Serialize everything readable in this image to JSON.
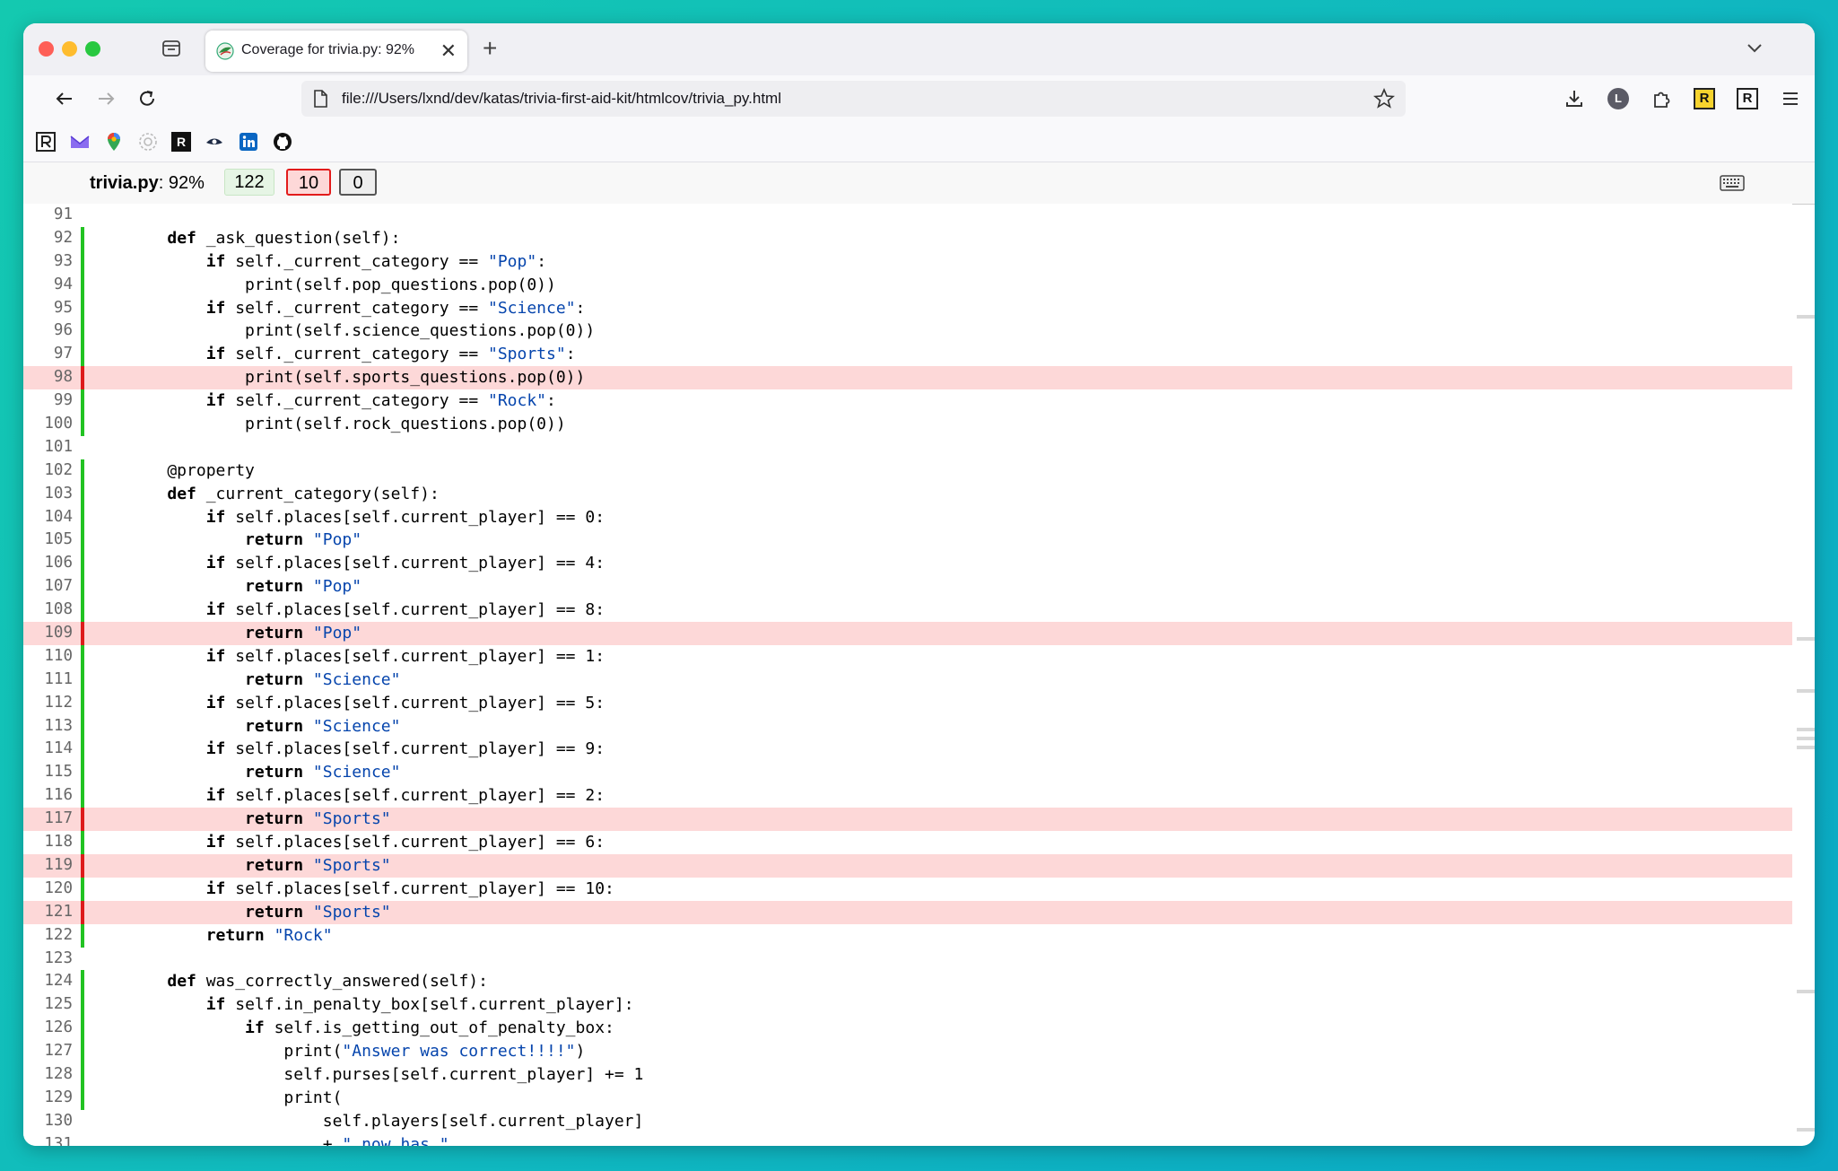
{
  "browser": {
    "tab_title": "Coverage for trivia.py: 92%",
    "tab_close": "✕",
    "new_tab": "+",
    "url": "file:///Users/lxnd/dev/katas/trivia-first-aid-kit/htmlcov/trivia_py.html",
    "avatar_letter": "L",
    "ext_r1": "R",
    "ext_r2": "R",
    "bookmark_r": "R"
  },
  "coverage": {
    "filename": "trivia.py",
    "percent": ": 92%",
    "run": "122",
    "missing": "10",
    "excluded": "0"
  },
  "source_lines": [
    {
      "n": "91",
      "s": "",
      "code": []
    },
    {
      "n": "92",
      "s": "run",
      "code": [
        [
          "    ",
          ""
        ],
        [
          "def",
          "kw"
        ],
        [
          " _ask_question(self):",
          ""
        ]
      ]
    },
    {
      "n": "93",
      "s": "run",
      "code": [
        [
          "        ",
          ""
        ],
        [
          "if",
          "kw"
        ],
        [
          " self._current_category == ",
          ""
        ],
        [
          "\"Pop\"",
          "str"
        ],
        [
          ":",
          ""
        ]
      ]
    },
    {
      "n": "94",
      "s": "run",
      "code": [
        [
          "            print(self.pop_questions.pop(0))",
          ""
        ]
      ]
    },
    {
      "n": "95",
      "s": "run",
      "code": [
        [
          "        ",
          ""
        ],
        [
          "if",
          "kw"
        ],
        [
          " self._current_category == ",
          ""
        ],
        [
          "\"Science\"",
          "str"
        ],
        [
          ":",
          ""
        ]
      ]
    },
    {
      "n": "96",
      "s": "run",
      "code": [
        [
          "            print(self.science_questions.pop(0))",
          ""
        ]
      ]
    },
    {
      "n": "97",
      "s": "run",
      "code": [
        [
          "        ",
          ""
        ],
        [
          "if",
          "kw"
        ],
        [
          " self._current_category == ",
          ""
        ],
        [
          "\"Sports\"",
          "str"
        ],
        [
          ":",
          ""
        ]
      ]
    },
    {
      "n": "98",
      "s": "mis",
      "code": [
        [
          "            print(self.sports_questions.pop(0))",
          ""
        ]
      ]
    },
    {
      "n": "99",
      "s": "run",
      "code": [
        [
          "        ",
          ""
        ],
        [
          "if",
          "kw"
        ],
        [
          " self._current_category == ",
          ""
        ],
        [
          "\"Rock\"",
          "str"
        ],
        [
          ":",
          ""
        ]
      ]
    },
    {
      "n": "100",
      "s": "run",
      "code": [
        [
          "            print(self.rock_questions.pop(0))",
          ""
        ]
      ]
    },
    {
      "n": "101",
      "s": "",
      "code": []
    },
    {
      "n": "102",
      "s": "run",
      "code": [
        [
          "    @property",
          ""
        ]
      ]
    },
    {
      "n": "103",
      "s": "run",
      "code": [
        [
          "    ",
          ""
        ],
        [
          "def",
          "kw"
        ],
        [
          " _current_category(self):",
          ""
        ]
      ]
    },
    {
      "n": "104",
      "s": "run",
      "code": [
        [
          "        ",
          ""
        ],
        [
          "if",
          "kw"
        ],
        [
          " self.places[self.current_player] == 0:",
          ""
        ]
      ]
    },
    {
      "n": "105",
      "s": "run",
      "code": [
        [
          "            ",
          ""
        ],
        [
          "return",
          "kw"
        ],
        [
          " ",
          ""
        ],
        [
          "\"Pop\"",
          "str"
        ]
      ]
    },
    {
      "n": "106",
      "s": "run",
      "code": [
        [
          "        ",
          ""
        ],
        [
          "if",
          "kw"
        ],
        [
          " self.places[self.current_player] == 4:",
          ""
        ]
      ]
    },
    {
      "n": "107",
      "s": "run",
      "code": [
        [
          "            ",
          ""
        ],
        [
          "return",
          "kw"
        ],
        [
          " ",
          ""
        ],
        [
          "\"Pop\"",
          "str"
        ]
      ]
    },
    {
      "n": "108",
      "s": "run",
      "code": [
        [
          "        ",
          ""
        ],
        [
          "if",
          "kw"
        ],
        [
          " self.places[self.current_player] == 8:",
          ""
        ]
      ]
    },
    {
      "n": "109",
      "s": "mis",
      "code": [
        [
          "            ",
          ""
        ],
        [
          "return",
          "kw"
        ],
        [
          " ",
          ""
        ],
        [
          "\"Pop\"",
          "str"
        ]
      ]
    },
    {
      "n": "110",
      "s": "run",
      "code": [
        [
          "        ",
          ""
        ],
        [
          "if",
          "kw"
        ],
        [
          " self.places[self.current_player] == 1:",
          ""
        ]
      ]
    },
    {
      "n": "111",
      "s": "run",
      "code": [
        [
          "            ",
          ""
        ],
        [
          "return",
          "kw"
        ],
        [
          " ",
          ""
        ],
        [
          "\"Science\"",
          "str"
        ]
      ]
    },
    {
      "n": "112",
      "s": "run",
      "code": [
        [
          "        ",
          ""
        ],
        [
          "if",
          "kw"
        ],
        [
          " self.places[self.current_player] == 5:",
          ""
        ]
      ]
    },
    {
      "n": "113",
      "s": "run",
      "code": [
        [
          "            ",
          ""
        ],
        [
          "return",
          "kw"
        ],
        [
          " ",
          ""
        ],
        [
          "\"Science\"",
          "str"
        ]
      ]
    },
    {
      "n": "114",
      "s": "run",
      "code": [
        [
          "        ",
          ""
        ],
        [
          "if",
          "kw"
        ],
        [
          " self.places[self.current_player] == 9:",
          ""
        ]
      ]
    },
    {
      "n": "115",
      "s": "run",
      "code": [
        [
          "            ",
          ""
        ],
        [
          "return",
          "kw"
        ],
        [
          " ",
          ""
        ],
        [
          "\"Science\"",
          "str"
        ]
      ]
    },
    {
      "n": "116",
      "s": "run",
      "code": [
        [
          "        ",
          ""
        ],
        [
          "if",
          "kw"
        ],
        [
          " self.places[self.current_player] == 2:",
          ""
        ]
      ]
    },
    {
      "n": "117",
      "s": "mis",
      "code": [
        [
          "            ",
          ""
        ],
        [
          "return",
          "kw"
        ],
        [
          " ",
          ""
        ],
        [
          "\"Sports\"",
          "str"
        ]
      ]
    },
    {
      "n": "118",
      "s": "run",
      "code": [
        [
          "        ",
          ""
        ],
        [
          "if",
          "kw"
        ],
        [
          " self.places[self.current_player] == 6:",
          ""
        ]
      ]
    },
    {
      "n": "119",
      "s": "mis",
      "code": [
        [
          "            ",
          ""
        ],
        [
          "return",
          "kw"
        ],
        [
          " ",
          ""
        ],
        [
          "\"Sports\"",
          "str"
        ]
      ]
    },
    {
      "n": "120",
      "s": "run",
      "code": [
        [
          "        ",
          ""
        ],
        [
          "if",
          "kw"
        ],
        [
          " self.places[self.current_player] == 10:",
          ""
        ]
      ]
    },
    {
      "n": "121",
      "s": "mis",
      "code": [
        [
          "            ",
          ""
        ],
        [
          "return",
          "kw"
        ],
        [
          " ",
          ""
        ],
        [
          "\"Sports\"",
          "str"
        ]
      ]
    },
    {
      "n": "122",
      "s": "run",
      "code": [
        [
          "        ",
          ""
        ],
        [
          "return",
          "kw"
        ],
        [
          " ",
          ""
        ],
        [
          "\"Rock\"",
          "str"
        ]
      ]
    },
    {
      "n": "123",
      "s": "",
      "code": []
    },
    {
      "n": "124",
      "s": "run",
      "code": [
        [
          "    ",
          ""
        ],
        [
          "def",
          "kw"
        ],
        [
          " was_correctly_answered(self):",
          ""
        ]
      ]
    },
    {
      "n": "125",
      "s": "run",
      "code": [
        [
          "        ",
          ""
        ],
        [
          "if",
          "kw"
        ],
        [
          " self.in_penalty_box[self.current_player]:",
          ""
        ]
      ]
    },
    {
      "n": "126",
      "s": "run",
      "code": [
        [
          "            ",
          ""
        ],
        [
          "if",
          "kw"
        ],
        [
          " self.is_getting_out_of_penalty_box:",
          ""
        ]
      ]
    },
    {
      "n": "127",
      "s": "run",
      "code": [
        [
          "                print(",
          ""
        ],
        [
          "\"Answer was correct!!!!\"",
          "str"
        ],
        [
          ")",
          ""
        ]
      ]
    },
    {
      "n": "128",
      "s": "run",
      "code": [
        [
          "                self.purses[self.current_player] += 1",
          ""
        ]
      ]
    },
    {
      "n": "129",
      "s": "run",
      "code": [
        [
          "                print(",
          ""
        ]
      ]
    },
    {
      "n": "130",
      "s": "",
      "code": [
        [
          "                    self.players[self.current_player]",
          ""
        ]
      ]
    },
    {
      "n": "131",
      "s": "",
      "code": [
        [
          "                    + ",
          ""
        ],
        [
          "\" now has \"",
          "str"
        ]
      ]
    }
  ]
}
